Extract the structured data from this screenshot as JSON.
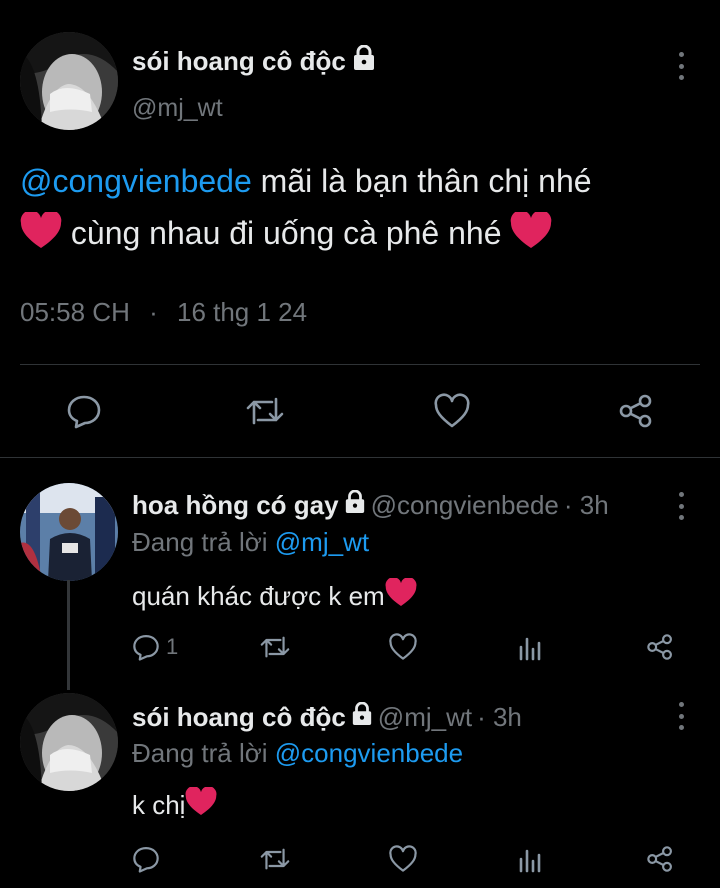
{
  "main_tweet": {
    "author_name": "sói hoang cô độc",
    "author_handle": "@mj_wt",
    "mention": "@congvienbede",
    "text_part1": " mãi là bạn thân chị nhé",
    "text_part2": " cùng nhau đi uống cà phê nhé ",
    "time": "05:58 CH",
    "separator": "·",
    "date": "16 thg 1 24"
  },
  "replies": [
    {
      "author_name": "hoa hồng có gay",
      "author_handle": "@congvienbede",
      "time_ago": "· 3h",
      "replying_label": "Đang trả lời ",
      "replying_to": "@mj_wt",
      "text": "quán khác được k em ",
      "reply_count": "1"
    },
    {
      "author_name": "sói hoang cô độc",
      "author_handle": "@mj_wt",
      "time_ago": "· 3h",
      "replying_label": "Đang trả lời ",
      "replying_to": "@congvienbede",
      "text": "k chị ",
      "reply_count": ""
    }
  ],
  "colors": {
    "background": "#000000",
    "text": "#e7e9ea",
    "muted": "#71767b",
    "link": "#1d9bf0",
    "heart": "#e0245e",
    "divider": "#2f3336"
  },
  "icons": [
    "lock-icon",
    "more-icon",
    "reply-icon",
    "retweet-icon",
    "like-icon",
    "share-icon",
    "views-icon",
    "heart-emoji"
  ]
}
